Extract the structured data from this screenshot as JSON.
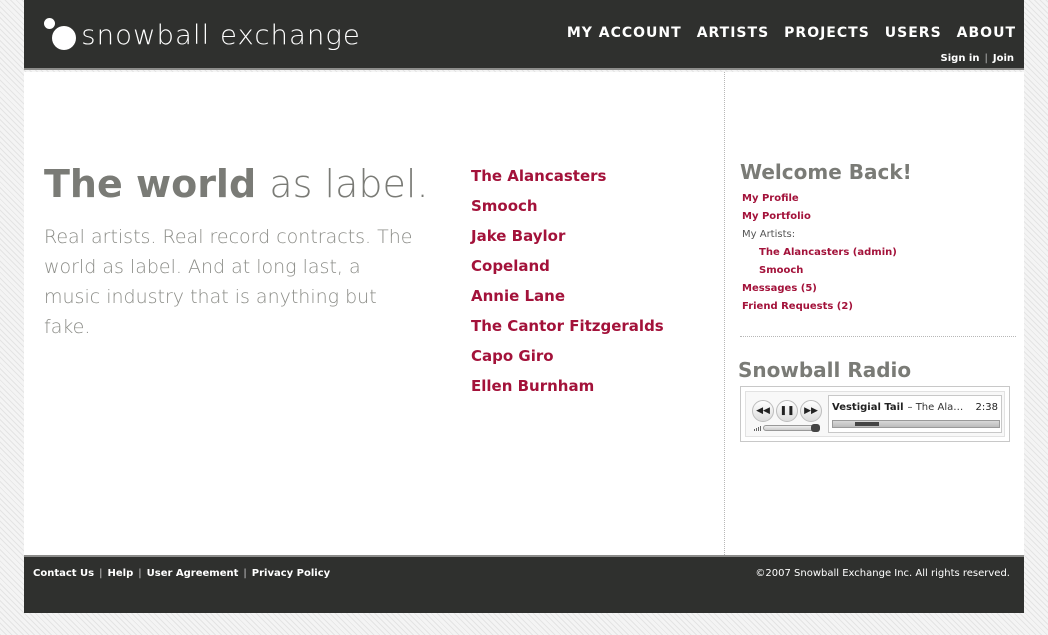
{
  "header": {
    "brand": "snowball exchange",
    "nav": [
      "MY ACCOUNT",
      "ARTISTS",
      "PROJECTS",
      "USERS",
      "ABOUT"
    ],
    "sign_in": "Sign in",
    "join": "Join",
    "auth_separator": "|"
  },
  "hero": {
    "title_bold": "The world",
    "title_light": "as label.",
    "text": "Real artists. Real record contracts. The world as label. And at long last, a music industry that is anything but fake."
  },
  "artists": [
    "The Alancasters",
    "Smooch",
    "Jake Baylor",
    "Copeland",
    "Annie Lane",
    "The Cantor Fitzgeralds",
    "Capo Giro",
    "Ellen Burnham"
  ],
  "sidebar": {
    "welcome": "Welcome Back!",
    "my_profile": "My Profile",
    "my_portfolio": "My Portfolio",
    "my_artists_label": "My Artists:",
    "my_artists": [
      "The Alancasters (admin)",
      "Smooch"
    ],
    "messages": "Messages (5)",
    "friend_requests": "Friend Requests (2)",
    "radio_title": "Snowball Radio"
  },
  "player": {
    "track": "Vestigial Tail",
    "artist": "– The Ala…",
    "time": "2:38",
    "progress": 0.15,
    "volume": 0.85,
    "icons": [
      "rewind-icon",
      "pause-icon",
      "forward-icon"
    ]
  },
  "footer": {
    "links": [
      "Contact Us",
      "Help",
      "User Agreement",
      "Privacy Policy"
    ],
    "separator": "|",
    "copyright": "©2007 Snowball Exchange Inc. All rights reserved."
  },
  "colors": {
    "bar": "#2f302e",
    "accent": "#a3123a",
    "heading": "#7a7b76"
  }
}
